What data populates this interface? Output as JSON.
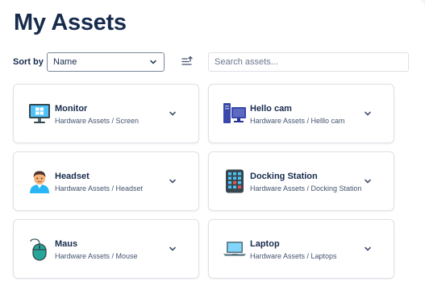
{
  "page": {
    "title": "My Assets"
  },
  "toolbar": {
    "sort_label": "Sort by",
    "sort_value": "Name",
    "sort_order_icon": "sort-ascending-icon",
    "search_placeholder": "Search assets..."
  },
  "assets": [
    {
      "name": "Monitor",
      "path": "Hardware Assets / Screen",
      "icon": "monitor-icon"
    },
    {
      "name": "Hello cam",
      "path": "Hardware Assets / Helllo cam",
      "icon": "desktop-computer-icon"
    },
    {
      "name": "Headset",
      "path": "Hardware Assets / Headset",
      "icon": "person-icon"
    },
    {
      "name": "Docking Station",
      "path": "Hardware Assets / Docking Station",
      "icon": "docking-station-icon"
    },
    {
      "name": "Maus",
      "path": "Hardware Assets / Mouse",
      "icon": "mouse-icon"
    },
    {
      "name": "Laptop",
      "path": "Hardware Assets / Laptops",
      "icon": "laptop-icon"
    }
  ]
}
